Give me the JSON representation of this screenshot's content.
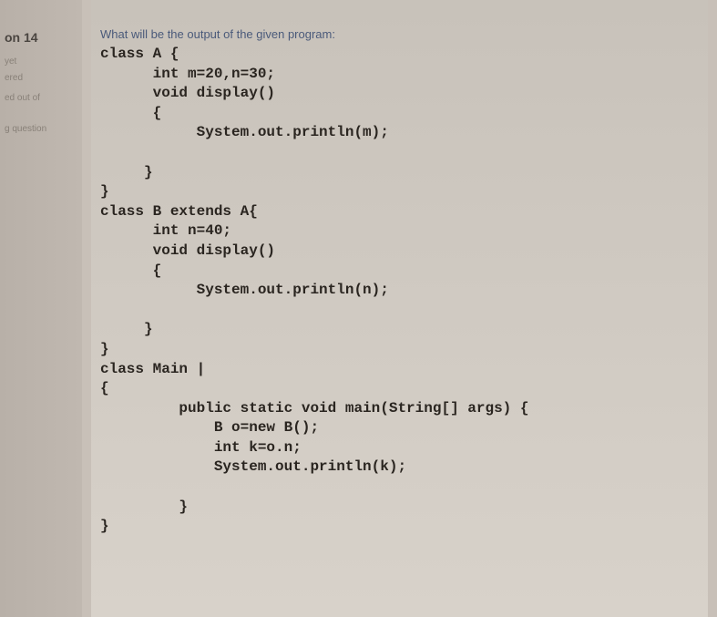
{
  "sidebar": {
    "question_num": "14",
    "status1": "yet",
    "status2": "ered",
    "status3": "ed out of",
    "status4": "g question"
  },
  "question": {
    "prompt": "What will be the output of the given program:",
    "code_lines": [
      "class A {",
      "      int m=20,n=30;",
      "      void display()",
      "      {",
      "           System.out.println(m);",
      "",
      "     }",
      "}",
      "class B extends A{",
      "      int n=40;",
      "      void display()",
      "      {",
      "           System.out.println(n);",
      "",
      "     }",
      "}",
      "class Main |",
      "{",
      "         public static void main(String[] args) {",
      "             B o=new B();",
      "             int k=o.n;",
      "             System.out.println(k);",
      "",
      "         }",
      "}"
    ]
  }
}
